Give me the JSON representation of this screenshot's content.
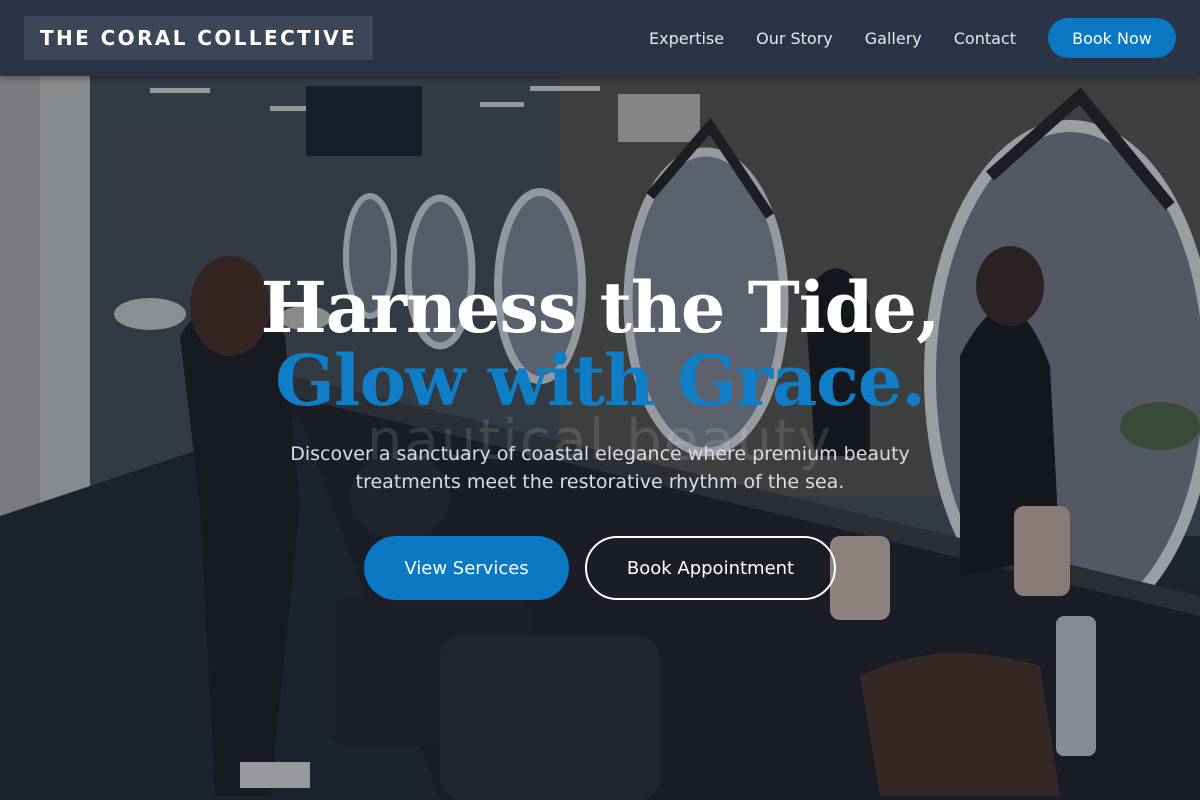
{
  "header": {
    "brand": "THE CORAL COLLECTIVE",
    "nav": [
      {
        "label": "Expertise"
      },
      {
        "label": "Our Story"
      },
      {
        "label": "Gallery"
      },
      {
        "label": "Contact"
      }
    ],
    "cta_label": "Book Now"
  },
  "hero": {
    "watermark": "nautical beauty",
    "headline_line1": "Harness the Tide,",
    "headline_line2": "Glow with Grace.",
    "subtext": "Discover a sanctuary of coastal elegance where premium beauty treatments meet the restorative rhythm of the sea.",
    "primary_button": "View Services",
    "secondary_button": "Book Appointment",
    "background_photo": "salon-interior-with-round-mirrors"
  },
  "colors": {
    "header_bg": "#2b3446",
    "accent_blue": "#0a78c2",
    "headline_accent": "#0f7ec7",
    "text_white": "#ffffff"
  }
}
